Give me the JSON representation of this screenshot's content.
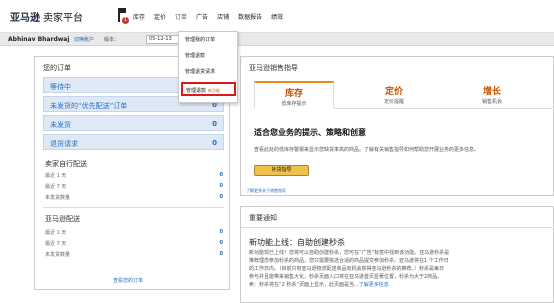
{
  "brand": {
    "logo": "亚马逊",
    "sub": "卖家平台"
  },
  "notification": {
    "count": "1"
  },
  "nav": [
    "库存",
    "定价",
    "订单",
    "广告",
    "店铺",
    "数据报告",
    "绩效"
  ],
  "userbar": {
    "user": "Abhinav Bhardwaj",
    "switch": "切换账户",
    "version": "版本：",
    "date": "05-12-13"
  },
  "dropdown": {
    "items": [
      "管理我的订单",
      "管理退款",
      "管理退货请求"
    ],
    "highlighted": {
      "label": "管理退款",
      "badge": "新功能"
    }
  },
  "orders_panel": {
    "title": "您的订单",
    "rows": [
      {
        "label": "等待中",
        "count": "0"
      },
      {
        "label": "未发货的“优先配送”订单",
        "count": "0"
      },
      {
        "label": "未发货",
        "count": "0"
      },
      {
        "label": "退货请求",
        "count": "0"
      }
    ],
    "seller_fulfilled": {
      "title": "卖家自行配送",
      "rows": [
        {
          "label": "最近 1 天",
          "count": "0"
        },
        {
          "label": "最近 7 天",
          "count": "0"
        },
        {
          "label": "未发货数量",
          "count": "0"
        }
      ]
    },
    "amazon_fulfilled": {
      "title": "亚马逊配送",
      "rows": [
        {
          "label": "最近 1 天",
          "count": "0"
        },
        {
          "label": "最近 7 天",
          "count": "0"
        },
        {
          "label": "未发货数量",
          "count": "0"
        }
      ]
    },
    "link": "查看您的订单"
  },
  "guide_panel": {
    "title": "亚马逊销售指导",
    "tabs": [
      {
        "title": "库存",
        "subtitle": "低库存提示"
      },
      {
        "title": "定价",
        "subtitle": "定价提醒"
      },
      {
        "title": "增长",
        "subtitle": "销售机会"
      }
    ],
    "heading": "适合您业务的提示、策略和创意",
    "body": "查看此处的低库存警报来显示您缺货率高的商品。了解有关销售指导如何帮助您开展业务的更多信息。",
    "button": "补货指导",
    "link": "了解更多关于销售指导"
  },
  "news_panel": {
    "title": "重要通知",
    "heading": "新功能上线：自助创建秒杀",
    "lines": [
      "新功能现已上线！您将可以自助创建秒杀，您可在“广告”标签中找到该功能。亚马逊秒杀是",
      "推荐理念参加秒杀的商品，您只需要挑选合适的商品提交参加秒杀。亚马逊将在1 个工作日",
      "的工作日内。（目前只有亚马逊物流配送商品有机会获得亚马逊秒杀的推荐。）秒杀是每日",
      "参与并且能带来销售大化，秒杀页面入口将在亚马逊首页显著位置，秒杀为大于2商品。"
    ],
    "last_line": {
      "text": "卖：秒杀将在“2 秒杀”页面上显示，此页面是当...",
      "link": "了解更多信息"
    }
  }
}
